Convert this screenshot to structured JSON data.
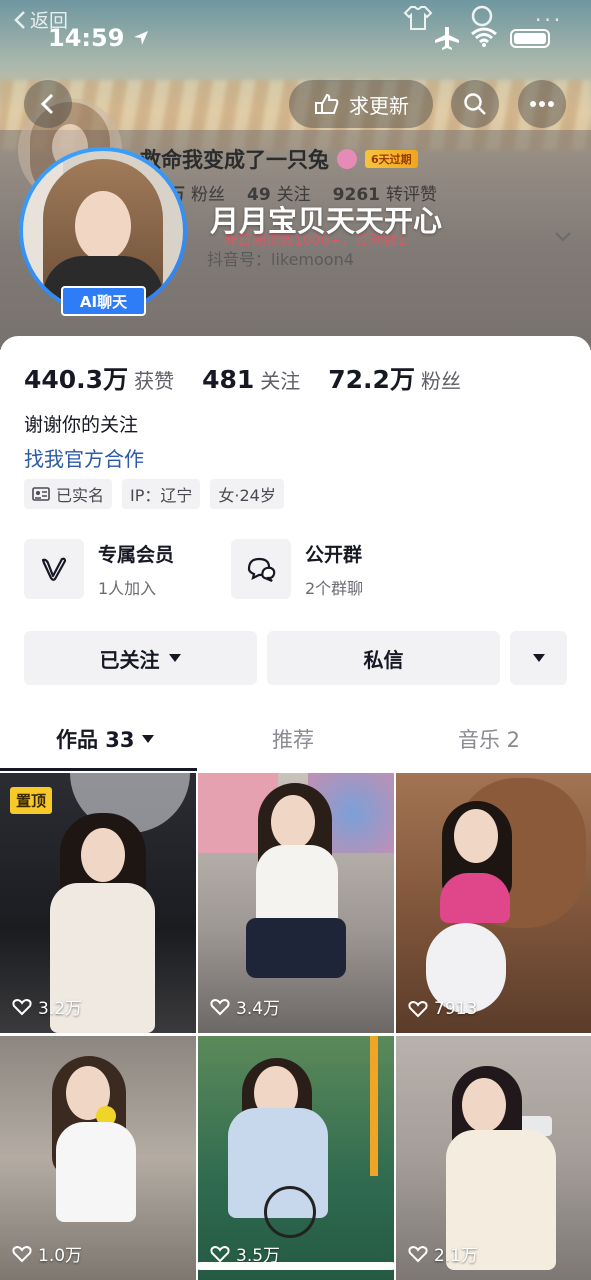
{
  "status_bar": {
    "back_label": "返回",
    "time": "14:59"
  },
  "header": {
    "update_label": "求更新",
    "bg_name": "救命我变成了一只兔",
    "bg_badge": "6天过期",
    "bg_stats": [
      {
        "value": "万",
        "label": "粉丝"
      },
      {
        "value": "49",
        "label": "关注"
      },
      {
        "value": "9261",
        "label": "转评赞"
      }
    ],
    "overlay_text": "月月宝贝天天开心",
    "bg_red_text": "昨日阅读数1000+，互动数1",
    "bg_douyin": "抖音号：likemoon4",
    "ai_chat_label": "AI聊天"
  },
  "profile": {
    "stats": [
      {
        "value": "440.3万",
        "label": "获赞"
      },
      {
        "value": "481",
        "label": "关注"
      },
      {
        "value": "72.2万",
        "label": "粉丝"
      }
    ],
    "bio": "谢谢你的关注",
    "link": "找我官方合作",
    "tags": [
      {
        "text": "已实名",
        "icon": "id-card-icon"
      },
      {
        "text": "IP：辽宁",
        "icon": ""
      },
      {
        "text": "女·24岁",
        "icon": ""
      }
    ],
    "features": [
      {
        "title": "专属会员",
        "sub": "1人加入",
        "icon": "v-member-icon"
      },
      {
        "title": "公开群",
        "sub": "2个群聊",
        "icon": "group-chat-icon"
      }
    ],
    "buttons": {
      "follow": "已关注",
      "message": "私信"
    }
  },
  "tabs": [
    {
      "label": "作品 33",
      "active": true
    },
    {
      "label": "推荐",
      "active": false
    },
    {
      "label": "音乐 2",
      "active": false
    }
  ],
  "videos": [
    {
      "likes": "3.2万",
      "pinned": "置顶"
    },
    {
      "likes": "3.4万"
    },
    {
      "likes": "7913"
    },
    {
      "likes": "1.0万"
    },
    {
      "likes": "3.5万"
    },
    {
      "likes": "2.1万"
    }
  ],
  "colors": {
    "accent_blue": "#2f7df6",
    "link_blue": "#2b5aa8",
    "pin_yellow": "#f7c929"
  }
}
